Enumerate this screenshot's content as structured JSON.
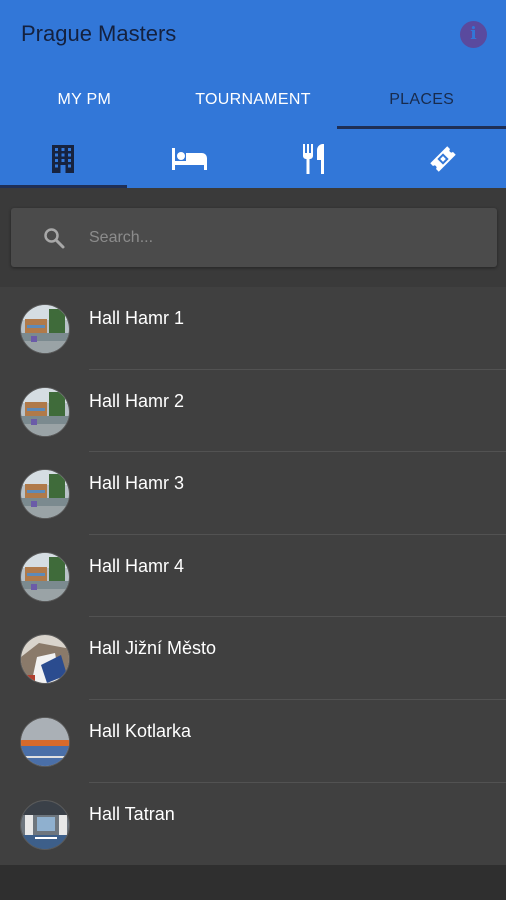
{
  "app": {
    "title": "Prague Masters",
    "info_icon": "info-icon"
  },
  "tabs": [
    {
      "label": "MY PM",
      "active": false
    },
    {
      "label": "TOURNAMENT",
      "active": false
    },
    {
      "label": "PLACES",
      "active": true
    }
  ],
  "icon_tabs": [
    {
      "icon": "building-icon",
      "active": true
    },
    {
      "icon": "bed-icon",
      "active": false
    },
    {
      "icon": "restaurant-icon",
      "active": false
    },
    {
      "icon": "ticket-icon",
      "active": false
    }
  ],
  "search": {
    "placeholder": "Search..."
  },
  "places": [
    {
      "label": "Hall Hamr 1",
      "thumb": "hamr"
    },
    {
      "label": "Hall Hamr 2",
      "thumb": "hamr"
    },
    {
      "label": "Hall Hamr 3",
      "thumb": "hamr"
    },
    {
      "label": "Hall Hamr 4",
      "thumb": "hamr"
    },
    {
      "label": "Hall Jižní Město",
      "thumb": "jizni"
    },
    {
      "label": "Hall Kotlarka",
      "thumb": "kotlarka"
    },
    {
      "label": "Hall Tatran",
      "thumb": "tatran"
    }
  ],
  "colors": {
    "primary": "#3277d8",
    "accent_dark": "#1f2f55",
    "list_bg": "#404040"
  }
}
